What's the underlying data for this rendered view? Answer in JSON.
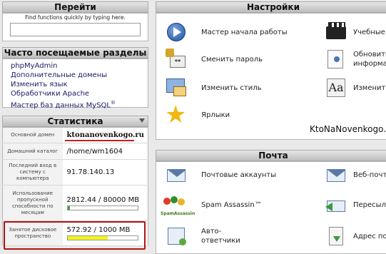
{
  "goto": {
    "title": "Перейти",
    "hint": "Find functions quickly by typing here.",
    "search_value": ""
  },
  "favorites": {
    "title": "Часто посещаемые разделы",
    "links": [
      "phpMyAdmin",
      "Дополнительные домены",
      "Изменить язык",
      "Обработчики Apache",
      "Мастер баз данных MySQL"
    ],
    "mysql_sup": "®"
  },
  "stats": {
    "title": "Статистика",
    "rows": [
      {
        "label": "Основной домен",
        "value": "ktonanovenkogo.ru"
      },
      {
        "label": "Домашний каталог",
        "value": "/home/wm1604"
      },
      {
        "label": "Последний вход в систему с компьютера",
        "value": "91.78.140.13"
      },
      {
        "label": "Использование пропускной способности по месяцам",
        "value": "2812.44 / 80000 MB",
        "fraction": 0.035
      },
      {
        "label": "Занятое дисковое пространство",
        "value": "572.92 / 1000 MB",
        "fraction": 0.573
      }
    ],
    "bar_color_bandwidth": "#3aa63a",
    "bar_color_disk": "#f4f420",
    "highlight_color": "#b31313"
  },
  "settings": {
    "title": "Настройки",
    "items": [
      {
        "label": "Мастер начала работы",
        "icon": "play-icon"
      },
      {
        "label": "Учебные",
        "icon": "film-icon"
      },
      {
        "label": "Сменить пароль",
        "icon": "lock-password-icon"
      },
      {
        "label": "Обновить",
        "label2": "информа",
        "icon": "contact-info-icon"
      },
      {
        "label": "Изменить стиль",
        "icon": "style-icon"
      },
      {
        "label": "Изменить",
        "icon": "font-icon"
      },
      {
        "label": "Ярлыки",
        "icon": "star-icon"
      }
    ],
    "watermark": "KtoNaNovenkogo.ru"
  },
  "mail": {
    "title": "Почта",
    "items": [
      {
        "label": "Почтовые аккаунты",
        "icon": "envelope-icon"
      },
      {
        "label": "Веб-почт",
        "icon": "webmail-icon"
      },
      {
        "label": "Spam Assassin™",
        "icon": "spamassassin-icon",
        "icon_text": "SpamAssassin"
      },
      {
        "label": "Пересыл",
        "icon": "forward-icon"
      },
      {
        "label": "Авто-",
        "label2": "ответчики",
        "icon": "autoresponder-icon"
      },
      {
        "label": "Адрес по",
        "icon": "default-address-icon"
      }
    ]
  }
}
